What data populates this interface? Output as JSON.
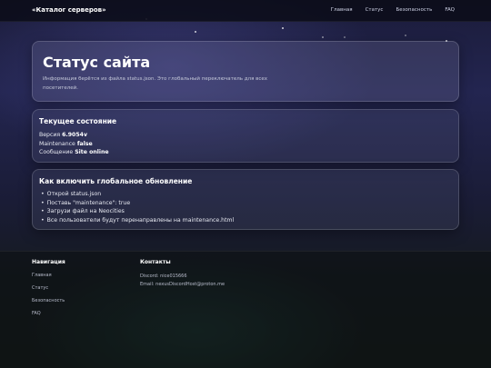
{
  "header": {
    "brand": "«Каталог серверов»",
    "nav": [
      "Главная",
      "Статус",
      "Безопасность",
      "FAQ"
    ]
  },
  "hero": {
    "title": "Статус сайта",
    "description": "Информация берётся из файла status.json. Это глобальный переключатель для всех посетителей."
  },
  "state": {
    "title": "Текущее состояние",
    "version_label": "Версия",
    "version_value": "6.9054v",
    "maintenance_label": "Maintenance",
    "maintenance_value": "false",
    "message_label": "Сообщение",
    "message_value": "Site online"
  },
  "how": {
    "title": "Как включить глобальное обновление",
    "steps": [
      "Открой status.json",
      "Поставь \"maintenance\": true",
      "Загрузи файл на Neocities",
      "Все пользователи будут перенаправлены на maintenance.html"
    ]
  },
  "footer": {
    "nav_title": "Навигация",
    "nav_links": [
      "Главная",
      "Статус",
      "Безопасность",
      "FAQ"
    ],
    "contacts_title": "Контакты",
    "discord": "Discord: nice015666",
    "email": "Email: nexusDiscordHost@proton.me"
  }
}
